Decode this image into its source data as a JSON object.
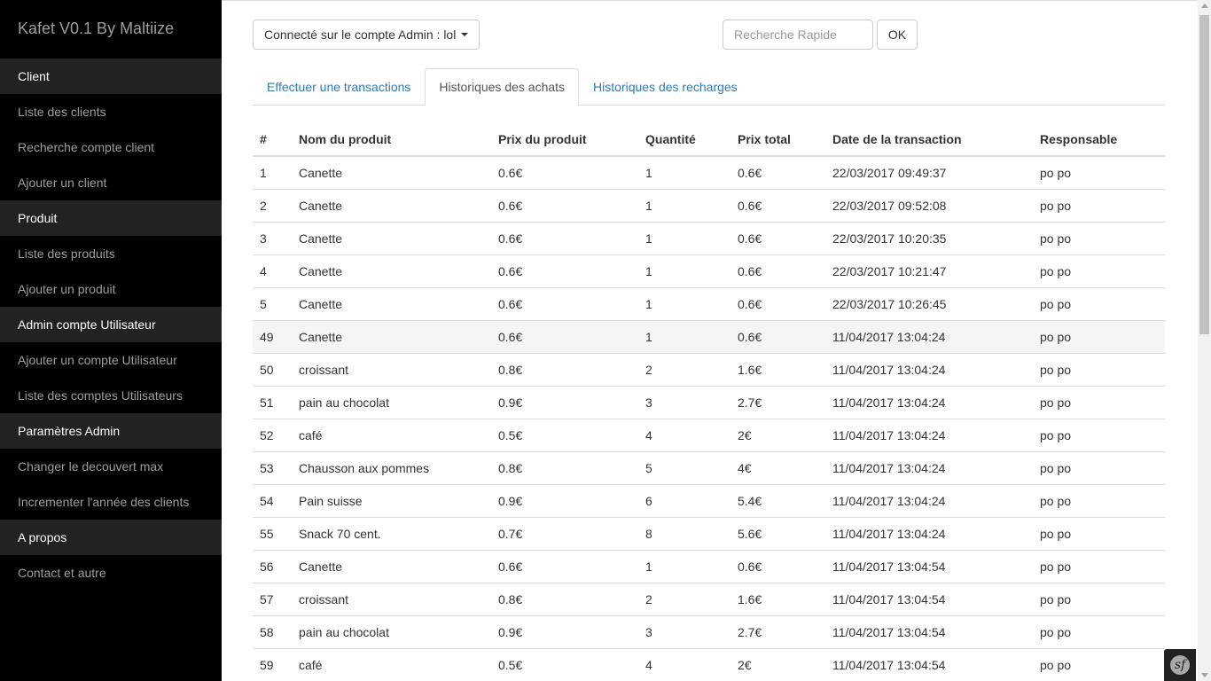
{
  "app": {
    "title": "Kafet V0.1 By Maltiize"
  },
  "sidebar": {
    "sections": [
      {
        "header": "Client",
        "items": [
          "Liste des clients",
          "Recherche compte client",
          "Ajouter un client"
        ]
      },
      {
        "header": "Produit",
        "items": [
          "Liste des produits",
          "Ajouter un produit"
        ]
      },
      {
        "header": "Admin compte Utilisateur",
        "items": [
          "Ajouter un compte Utilisateur",
          "Liste des comptes Utilisateurs"
        ]
      },
      {
        "header": "Paramètres Admin",
        "items": [
          "Changer le decouvert max",
          "Incrementer l'année des clients"
        ]
      },
      {
        "header": "A propos",
        "items": [
          "Contact et autre"
        ]
      }
    ]
  },
  "topbar": {
    "account_label": "Connecté sur le compte Admin : lol",
    "search_placeholder": "Recherche Rapide",
    "search_value": "",
    "ok_label": "OK"
  },
  "tabs": [
    {
      "label": "Effectuer une transactions",
      "active": false
    },
    {
      "label": "Historiques des achats",
      "active": true
    },
    {
      "label": "Historiques des recharges",
      "active": false
    }
  ],
  "table": {
    "columns": [
      "#",
      "Nom du produit",
      "Prix du produit",
      "Quantité",
      "Prix total",
      "Date de la transaction",
      "Responsable"
    ],
    "rows": [
      [
        "1",
        "Canette",
        "0.6€",
        "1",
        "0.6€",
        "22/03/2017 09:49:37",
        "po po"
      ],
      [
        "2",
        "Canette",
        "0.6€",
        "1",
        "0.6€",
        "22/03/2017 09:52:08",
        "po po"
      ],
      [
        "3",
        "Canette",
        "0.6€",
        "1",
        "0.6€",
        "22/03/2017 10:20:35",
        "po po"
      ],
      [
        "4",
        "Canette",
        "0.6€",
        "1",
        "0.6€",
        "22/03/2017 10:21:47",
        "po po"
      ],
      [
        "5",
        "Canette",
        "0.6€",
        "1",
        "0.6€",
        "22/03/2017 10:26:45",
        "po po"
      ],
      [
        "49",
        "Canette",
        "0.6€",
        "1",
        "0.6€",
        "11/04/2017 13:04:24",
        "po po"
      ],
      [
        "50",
        "croissant",
        "0.8€",
        "2",
        "1.6€",
        "11/04/2017 13:04:24",
        "po po"
      ],
      [
        "51",
        "pain au chocolat",
        "0.9€",
        "3",
        "2.7€",
        "11/04/2017 13:04:24",
        "po po"
      ],
      [
        "52",
        "café",
        "0.5€",
        "4",
        "2€",
        "11/04/2017 13:04:24",
        "po po"
      ],
      [
        "53",
        "Chausson aux pommes",
        "0.8€",
        "5",
        "4€",
        "11/04/2017 13:04:24",
        "po po"
      ],
      [
        "54",
        "Pain suisse",
        "0.9€",
        "6",
        "5.4€",
        "11/04/2017 13:04:24",
        "po po"
      ],
      [
        "55",
        "Snack 70 cent.",
        "0.7€",
        "8",
        "5.6€",
        "11/04/2017 13:04:24",
        "po po"
      ],
      [
        "56",
        "Canette",
        "0.6€",
        "1",
        "0.6€",
        "11/04/2017 13:04:54",
        "po po"
      ],
      [
        "57",
        "croissant",
        "0.8€",
        "2",
        "1.6€",
        "11/04/2017 13:04:54",
        "po po"
      ],
      [
        "58",
        "pain au chocolat",
        "0.9€",
        "3",
        "2.7€",
        "11/04/2017 13:04:54",
        "po po"
      ],
      [
        "59",
        "café",
        "0.5€",
        "4",
        "2€",
        "11/04/2017 13:04:54",
        "po po"
      ]
    ],
    "highlighted_row": 5
  },
  "badge": {
    "icon": "symfony-icon",
    "glyph": "sf"
  }
}
